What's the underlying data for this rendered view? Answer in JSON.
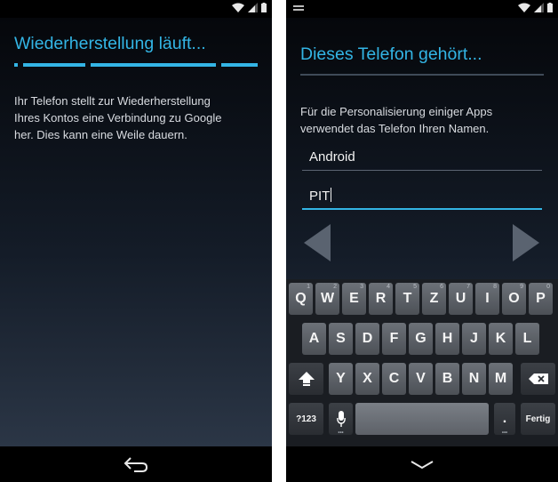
{
  "left_screen": {
    "title": "Wiederherstellung läuft...",
    "body": "Ihr Telefon stellt zur Wiederherstellung\nIhres Kontos eine Verbindung zu Google\nher. Dies kann eine Weile dauern.",
    "nav_icon": "back-icon"
  },
  "right_screen": {
    "title": "Dieses Telefon gehört...",
    "body": "Für die Personalisierung einiger Apps\nverwendet das Telefon Ihren Namen.",
    "first_name": "Android",
    "last_name": "PIT",
    "nav_icon": "hide-keyboard-icon",
    "keyboard": {
      "row1": [
        {
          "label": "Q",
          "hint": "1"
        },
        {
          "label": "W",
          "hint": "2"
        },
        {
          "label": "E",
          "hint": "3"
        },
        {
          "label": "R",
          "hint": "4"
        },
        {
          "label": "T",
          "hint": "5"
        },
        {
          "label": "Z",
          "hint": "6"
        },
        {
          "label": "U",
          "hint": "7"
        },
        {
          "label": "I",
          "hint": "8"
        },
        {
          "label": "O",
          "hint": "9"
        },
        {
          "label": "P",
          "hint": "0"
        }
      ],
      "row2": [
        "A",
        "S",
        "D",
        "F",
        "G",
        "H",
        "J",
        "K",
        "L"
      ],
      "row3": [
        "Y",
        "X",
        "C",
        "V",
        "B",
        "N",
        "M"
      ],
      "symbols_label": "?123",
      "period_label": ".",
      "enter_label": "Fertig",
      "shift_icon": "shift-icon",
      "delete_icon": "backspace-icon",
      "mic_icon": "microphone-icon"
    }
  },
  "colors": {
    "accent": "#33b5e5",
    "status_bar": "#000000",
    "background_top": "#05070b",
    "background_bottom": "#2b3646"
  }
}
